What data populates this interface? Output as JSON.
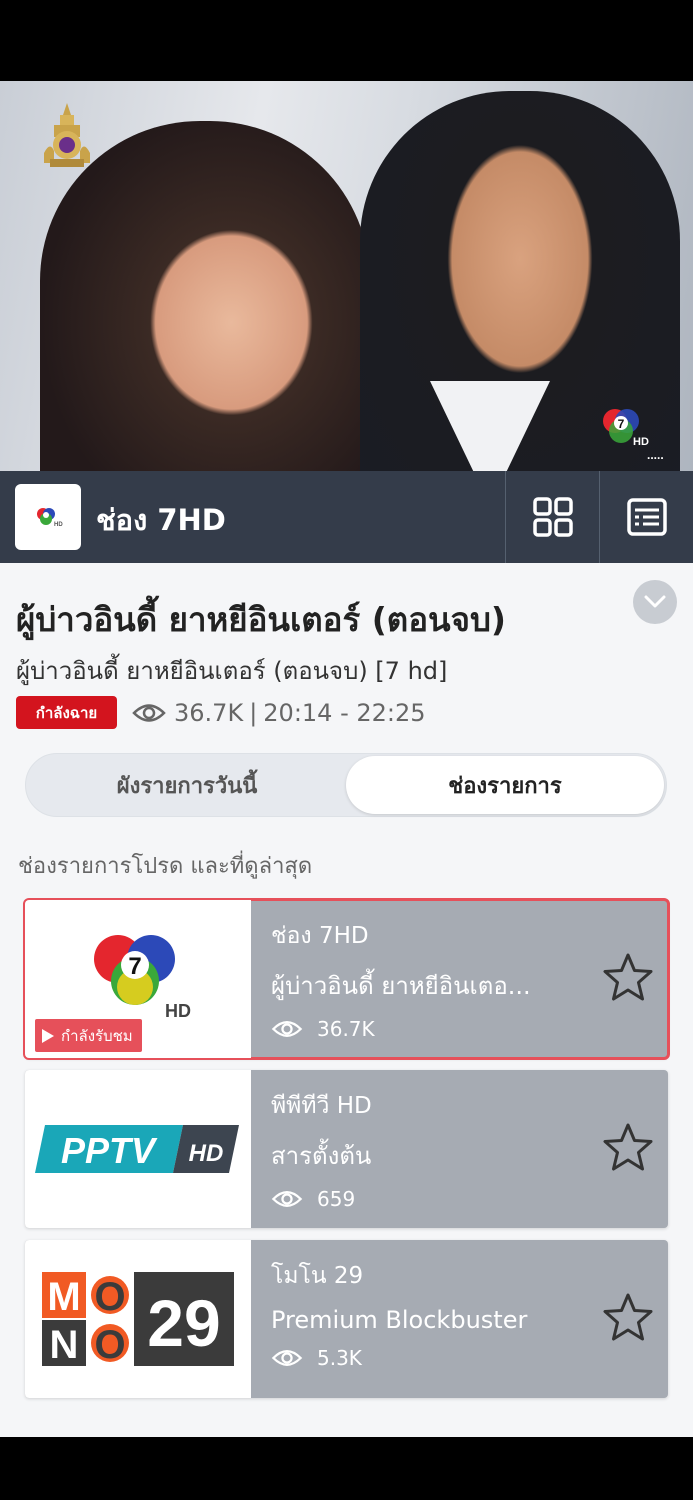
{
  "player": {
    "royal_emblem_icon": "royal-emblem-icon",
    "watermark_icon": "ch7hd-logo-icon",
    "watermark_dots": "....."
  },
  "channel_bar": {
    "channel_name": "ช่อง 7HD",
    "grid_icon": "grid-view-icon",
    "list_icon": "program-list-icon"
  },
  "program": {
    "title": "ผู้บ่าวอินดี้ ยาหยีอินเตอร์ (ตอนจบ)",
    "subtitle": "ผู้บ่าวอินดี้ ยาหยีอินเตอร์ (ตอนจบ) [7 hd]",
    "live_badge": "กำลังฉาย",
    "viewers": "36.7K",
    "separator": "|",
    "time_range": "20:14 - 22:25"
  },
  "tabs": [
    {
      "label": "ผังรายการวันนี้",
      "selected": false
    },
    {
      "label": "ช่องรายการ",
      "selected": true
    }
  ],
  "section_title": "ช่องรายการโปรด และที่ดูล่าสุด",
  "channels": [
    {
      "name": "ช่อง 7HD",
      "program": "ผู้บ่าวอินดี้ ยาหยีอินเตอ...",
      "views": "36.7K",
      "watching_label": "กำลังรับชม",
      "logo": "ch7hd-logo"
    },
    {
      "name": "พีพีทีวี HD",
      "program": "สารตั้งต้น",
      "views": "659",
      "logo": "pptv-hd-logo",
      "logo_text_main": "PPTV",
      "logo_text_hd": "HD"
    },
    {
      "name": "โมโน 29",
      "program": "Premium Blockbuster",
      "views": "5.3K",
      "logo": "mono29-logo",
      "logo_letters": [
        "M",
        "O",
        "N",
        "O"
      ],
      "logo_number": "29"
    }
  ],
  "colors": {
    "channel_bar_bg": "#343c4a",
    "live_red": "#d3141e",
    "active_outline": "#e6505a",
    "card_bg": "#a6abb3",
    "mono_orange": "#f15a24",
    "pptv_teal": "#1aa7b8"
  }
}
